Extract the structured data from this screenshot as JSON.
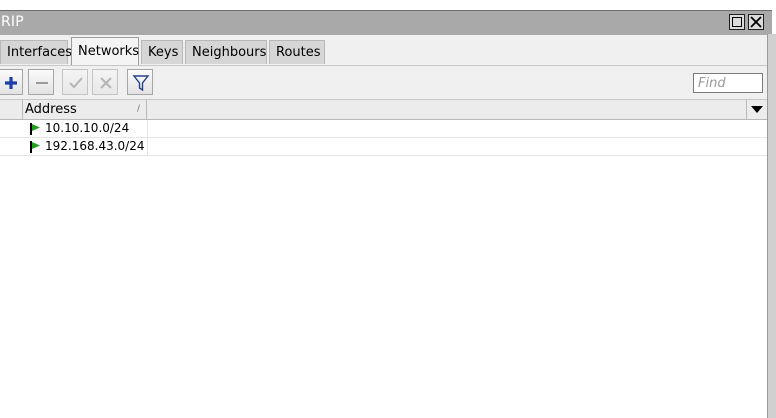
{
  "window": {
    "title": "RIP"
  },
  "tabs": [
    {
      "label": "Interfaces",
      "active": false
    },
    {
      "label": "Networks",
      "active": true
    },
    {
      "label": "Keys",
      "active": false
    },
    {
      "label": "Neighbours",
      "active": false
    },
    {
      "label": "Routes",
      "active": false
    }
  ],
  "toolbar": {
    "buttons": [
      {
        "icon": "plus-icon"
      },
      {
        "icon": "minus-icon"
      },
      {
        "icon": "check-icon"
      },
      {
        "icon": "cross-icon"
      },
      {
        "icon": "filter-icon"
      }
    ],
    "find_placeholder": "Find"
  },
  "table": {
    "columns": [
      "Address"
    ],
    "rows": [
      {
        "icon": "green-flag-icon",
        "address": "10.10.10.0/24"
      },
      {
        "icon": "green-flag-icon",
        "address": "192.168.43.0/24"
      }
    ]
  },
  "colors": {
    "flag": "#1fa11f",
    "plus": "#1b3fa8",
    "titlebar": "#a9a9a9"
  }
}
